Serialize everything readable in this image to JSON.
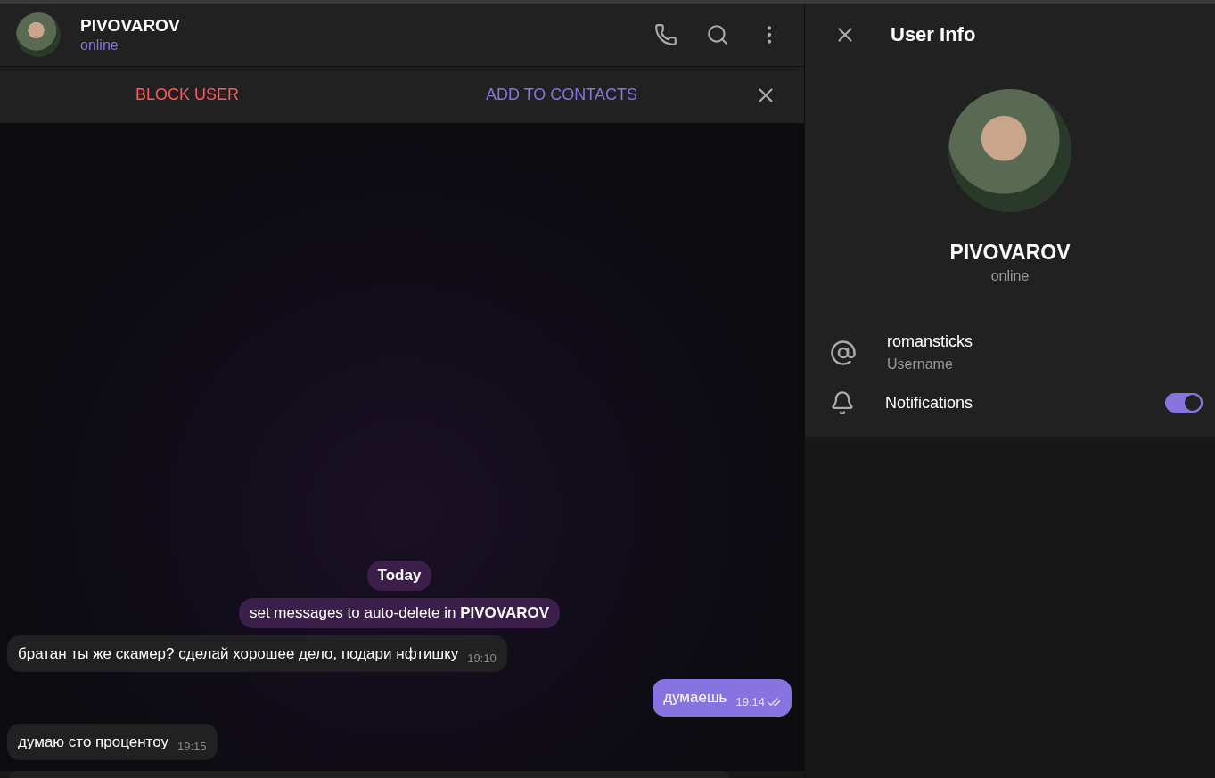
{
  "chat_header": {
    "name": "PIVOVAROV",
    "status": "online"
  },
  "action_bar": {
    "block": "BLOCK USER",
    "add": "ADD TO CONTACTS"
  },
  "messages": [
    {
      "kind": "date",
      "text": "Today"
    },
    {
      "kind": "service",
      "text": "set messages to auto-delete in **PIVOVAROV**"
    },
    {
      "kind": "incoming",
      "text": "братан ты же скамер? сделай хорошее дело, подари нфтишку",
      "time": "19:10"
    },
    {
      "kind": "outgoing",
      "text": "думаешь",
      "time": "19:14",
      "read": true
    },
    {
      "kind": "incoming",
      "text": "думаю сто процентоу",
      "time": "19:15"
    }
  ],
  "user_info": {
    "title": "User Info",
    "name": "PIVOVAROV",
    "status": "online",
    "username": "romansticks",
    "username_label": "Username",
    "notifications_label": "Notifications",
    "notifications_on": true
  }
}
